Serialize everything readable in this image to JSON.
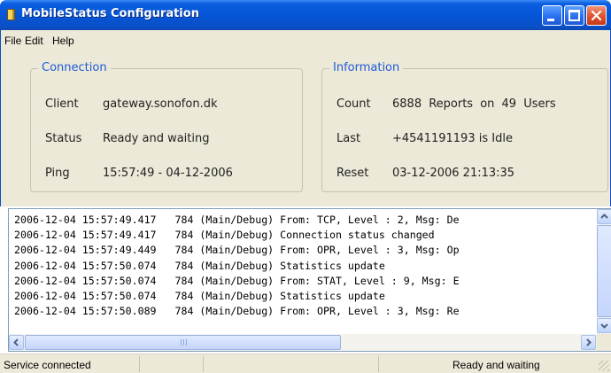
{
  "window": {
    "title": "MobileStatus Configuration",
    "titlebar_color": "#0655d8",
    "icon": "app-icon",
    "controls": [
      "minimize-icon",
      "maximize-icon",
      "close-icon"
    ]
  },
  "menu": {
    "items": [
      "File",
      "Edit",
      "Help"
    ]
  },
  "connection": {
    "legend": "Connection",
    "client_label": "Client",
    "client_value": "gateway.sonofon.dk",
    "status_label": "Status",
    "status_value": "Ready and waiting",
    "ping_label": "Ping",
    "ping_value": "15:57:49 - 04-12-2006"
  },
  "information": {
    "legend": "Information",
    "count_label": "Count",
    "count_value": "6888 Reports  on 49  Users",
    "last_label": "Last",
    "last_value": "+4541191193 is Idle",
    "reset_label": "Reset",
    "reset_value": "03-12-2006 21:13:35"
  },
  "log": {
    "lines": [
      "2006-12-04 15:57:49.417   784 (Main/Debug) From: TCP, Level : 2, Msg: De",
      "2006-12-04 15:57:49.417   784 (Main/Debug) Connection status changed",
      "2006-12-04 15:57:49.449   784 (Main/Debug) From: OPR, Level : 3, Msg: Op",
      "2006-12-04 15:57:50.074   784 (Main/Debug) Statistics update",
      "2006-12-04 15:57:50.074   784 (Main/Debug) From: STAT, Level : 9, Msg: E",
      "2006-12-04 15:57:50.074   784 (Main/Debug) Statistics update",
      "2006-12-04 15:57:50.089   784 (Main/Debug) From: OPR, Level : 3, Msg: Re"
    ]
  },
  "status_bar": {
    "left": "Service connected",
    "right": "Ready and waiting"
  },
  "colors": {
    "accent_text": "#1f5ad8",
    "panel_bg": "#ece9d8"
  }
}
